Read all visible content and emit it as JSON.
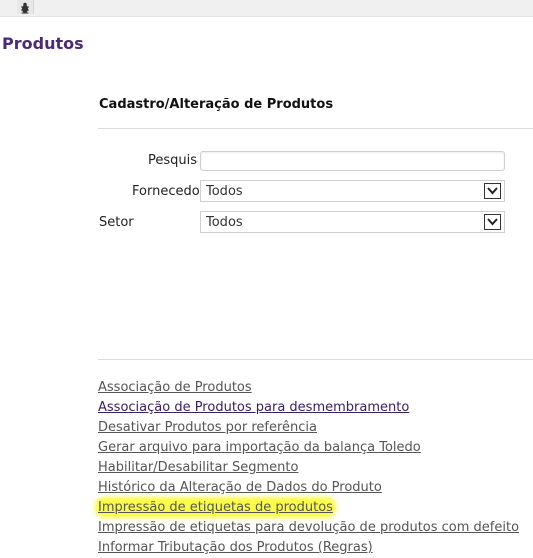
{
  "page": {
    "title": "Produtos"
  },
  "form": {
    "section_title": "Cadastro/Alteração de Produtos",
    "pesquisa_label": "Pesquisa",
    "pesquisa_value": "",
    "fornecedor_label": "Fornecedor",
    "fornecedor_value": "Todos",
    "setor_label": "Setor",
    "setor_value": "Todos"
  },
  "links": [
    "Associação de Produtos",
    "Associação de Produtos para desmembramento",
    "Desativar Produtos por referência",
    "Gerar arquivo para importação da balança Toledo",
    "Habilitar/Desabilitar Segmento",
    "Histórico da Alteração de Dados do Produto",
    "Impressão de etiquetas de produtos",
    "Impressão de etiquetas para devolução de produtos com defeito",
    "Informar Tributação dos Produtos (Regras)"
  ],
  "highlight_color": "#fbfb4a",
  "title_color": "#4b2a78"
}
